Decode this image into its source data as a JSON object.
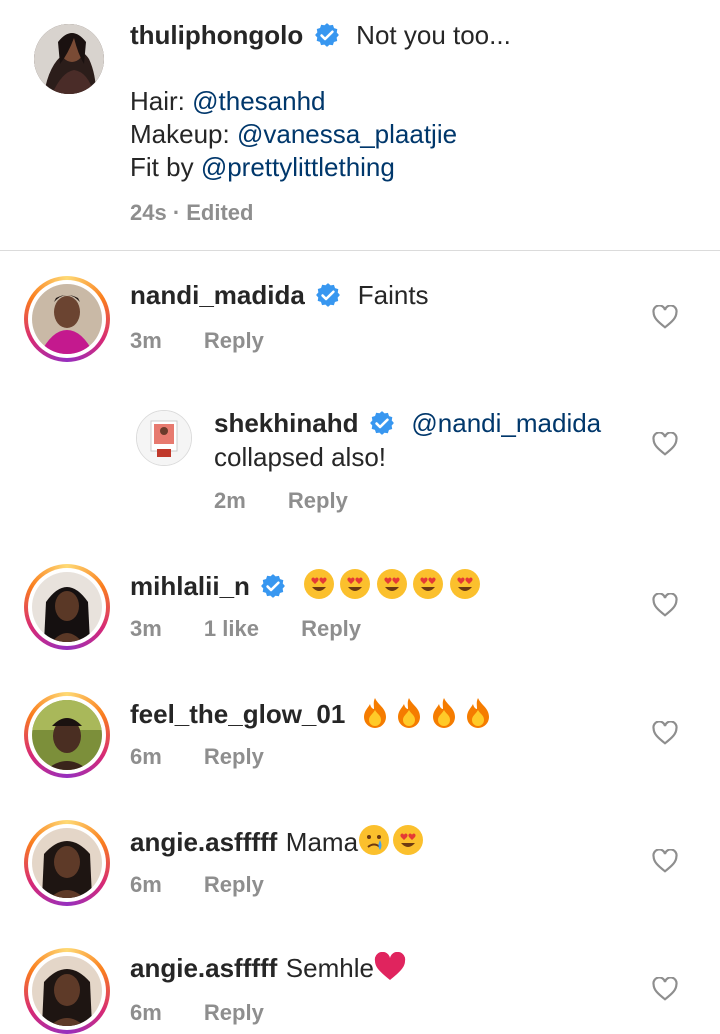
{
  "caption": {
    "username": "thuliphongolo",
    "text": "Not you too...",
    "hair_label": "Hair:",
    "hair_mention": "@thesanhd",
    "makeup_label": "Makeup:",
    "makeup_mention": "@vanessa_plaatjie",
    "fit_label": "Fit by",
    "fit_mention": "@prettylittlething",
    "meta": "24s · Edited"
  },
  "comments": [
    {
      "username": "nandi_madida",
      "text": "Faints",
      "time": "3m",
      "reply": "Reply",
      "verified": true
    },
    {
      "username": "shekhinahd",
      "mention": "@nandi_madida",
      "text": "collapsed also!",
      "time": "2m",
      "reply": "Reply",
      "verified": true
    },
    {
      "username": "mihlalii_n",
      "time": "3m",
      "likes": "1 like",
      "reply": "Reply",
      "verified": true
    },
    {
      "username": "feel_the_glow_01",
      "time": "6m",
      "reply": "Reply",
      "verified": false
    },
    {
      "username": "angie.asfffff",
      "text": "Mama",
      "time": "6m",
      "reply": "Reply",
      "verified": false
    },
    {
      "username": "angie.asfffff",
      "text": "Semhle",
      "time": "6m",
      "reply": "Reply",
      "verified": false
    }
  ],
  "colors": {
    "mention": "#00376b",
    "meta": "#8e8e8e",
    "verified": "#3897f0",
    "heart_emoji": "#e0245e"
  },
  "icons": [
    "verified-badge-icon",
    "heart-outline-icon",
    "heart-eyes-emoji",
    "fire-emoji",
    "crying-emoji",
    "red-heart-emoji"
  ]
}
